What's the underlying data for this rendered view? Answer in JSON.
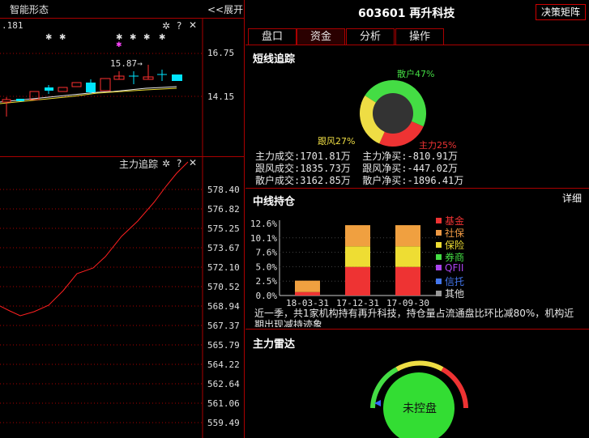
{
  "left_panel": {
    "title": "智能形态",
    "expand_label": "<<展开",
    "price_partial": ".181",
    "price_axis": [
      "16.75",
      "14.15"
    ],
    "peak_label": "15.87→",
    "icons": [
      "gear-icon",
      "help-icon",
      "close-icon"
    ]
  },
  "main_tracking": {
    "title": "主力追踪",
    "axis_labels": [
      "578.40",
      "576.82",
      "575.25",
      "573.67",
      "572.10",
      "570.52",
      "568.94",
      "567.37",
      "565.79",
      "564.22",
      "562.64",
      "561.06",
      "559.49"
    ],
    "line_color": "#ff2020"
  },
  "header": {
    "stock": "603601  再升科技",
    "decision_button": "决策矩阵"
  },
  "tabs": [
    "盘口",
    "资金",
    "分析",
    "操作"
  ],
  "active_tab": "资金",
  "short_term": {
    "title": "短线追踪",
    "donut": [
      {
        "label": "散户47%",
        "value": 47,
        "color": "#44dd44"
      },
      {
        "label": "主力25%",
        "value": 25,
        "color": "#ee3333"
      },
      {
        "label": "跟风27%",
        "value": 27,
        "color": "#eedd44"
      }
    ],
    "rows": [
      "主力成交:1701.81万  主力净买:-810.91万",
      "跟风成交:1835.73万  跟风净买:-447.02万",
      "散户成交:3162.85万  散户净买:-1896.41万"
    ]
  },
  "mid_term": {
    "title": "中线持仓",
    "detail_link": "详细",
    "summary": "近一季，共1家机构持有再升科技，持仓量占流通盘比环比减80%，机构近期出现减持迹象"
  },
  "chart_data": {
    "type": "bar",
    "stacked": true,
    "categories": [
      "18-03-31",
      "17-12-31",
      "17-09-30"
    ],
    "y_ticks": [
      "12.6%",
      "10.1%",
      "7.6%",
      "5.0%",
      "2.5%",
      "0.0%"
    ],
    "ylim": [
      0,
      12.6
    ],
    "series": [
      {
        "name": "基金",
        "color": "#ee3333",
        "values": [
          0.6,
          5.0,
          5.0
        ]
      },
      {
        "name": "社保",
        "color": "#ee9944",
        "values": [
          0,
          0,
          0
        ]
      },
      {
        "name": "保险",
        "color": "#eedd33",
        "values": [
          0,
          3.6,
          3.6
        ]
      },
      {
        "name": "券商",
        "color": "#44dd44",
        "values": [
          0,
          0,
          0
        ]
      },
      {
        "name": "QFII",
        "color": "#aa44ee",
        "values": [
          0,
          0,
          0
        ]
      },
      {
        "name": "信托",
        "color": "#4477ee",
        "values": [
          0,
          0,
          0
        ]
      },
      {
        "name": "其他",
        "color": "#999999",
        "values": [
          2.0,
          3.7,
          3.7
        ]
      }
    ]
  },
  "radar": {
    "title": "主力雷达",
    "status": "未控盘"
  }
}
